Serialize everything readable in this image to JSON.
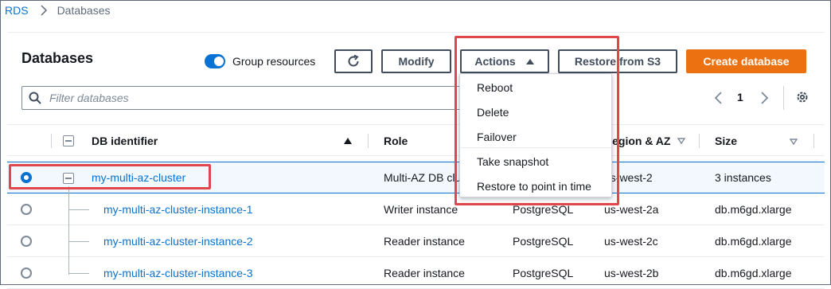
{
  "breadcrumb": {
    "root": "RDS",
    "current": "Databases"
  },
  "header": {
    "title": "Databases",
    "group_resources_label": "Group resources",
    "group_resources_on": true
  },
  "toolbar": {
    "modify": "Modify",
    "actions": "Actions",
    "restore_s3": "Restore from S3",
    "create": "Create database"
  },
  "search": {
    "placeholder": "Filter databases"
  },
  "pagination": {
    "page": "1"
  },
  "columns": {
    "db_identifier": "DB identifier",
    "role": "Role",
    "region_az": "Region & AZ",
    "size": "Size"
  },
  "rows": [
    {
      "id": "my-multi-az-cluster",
      "role": "Multi-AZ DB cluster",
      "engine": "",
      "region": "us-west-2",
      "size": "3 instances",
      "selected": true
    },
    {
      "id": "my-multi-az-cluster-instance-1",
      "role": "Writer instance",
      "engine": "PostgreSQL",
      "region": "us-west-2a",
      "size": "db.m6gd.xlarge",
      "selected": false
    },
    {
      "id": "my-multi-az-cluster-instance-2",
      "role": "Reader instance",
      "engine": "PostgreSQL",
      "region": "us-west-2c",
      "size": "db.m6gd.xlarge",
      "selected": false
    },
    {
      "id": "my-multi-az-cluster-instance-3",
      "role": "Reader instance",
      "engine": "PostgreSQL",
      "region": "us-west-2b",
      "size": "db.m6gd.xlarge",
      "selected": false
    }
  ],
  "actions_menu": {
    "reboot": "Reboot",
    "delete": "Delete",
    "failover": "Failover",
    "snapshot": "Take snapshot",
    "restore_pit": "Restore to point in time"
  },
  "colors": {
    "accent": "#0972d3",
    "primary_button": "#ec7211",
    "highlight": "#e0474c"
  }
}
